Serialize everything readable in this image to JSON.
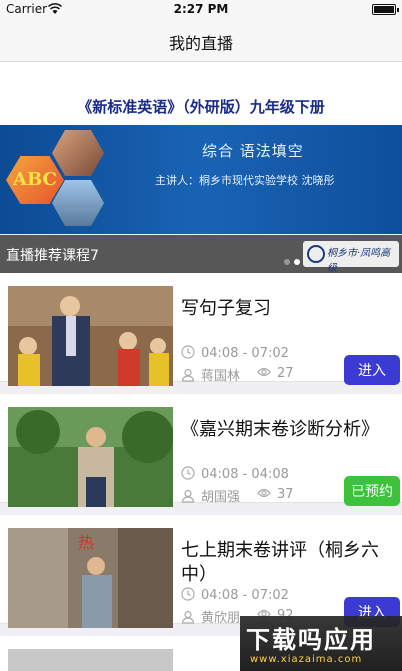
{
  "status_bar": {
    "carrier": "Carrier",
    "time": "2:27 PM",
    "battery_level": 0.9
  },
  "nav": {
    "title": "我的直播"
  },
  "banner": {
    "title": "《新标准英语》（外研版）九年级下册",
    "subject": "综合  语法填空",
    "lecturer": "主讲人：桐乡市现代实验学校  沈晓彤",
    "abc_text": "ABC",
    "overlay_label": "直播推荐课程7",
    "dots_total": 3,
    "dots_active_index": 1,
    "school_logo_text": "桐乡市·凤鸣高级"
  },
  "courses": [
    {
      "title": "写句子复习",
      "time": "04:08 - 07:02",
      "teacher": "蒋国林",
      "views": "27",
      "action": "进入",
      "action_type": "enter"
    },
    {
      "title": "《嘉兴期末卷诊断分析》",
      "time": "04:08 - 04:08",
      "teacher": "胡国强",
      "views": "37",
      "action": "已预约",
      "action_type": "reserved"
    },
    {
      "title": "七上期末卷讲评（桐乡六中）",
      "time": "04:08 - 07:02",
      "teacher": "黄欣朋",
      "views": "92",
      "action": "进入",
      "action_type": "enter"
    }
  ],
  "watermark": {
    "big": "下载吗应用",
    "small": "www.xiazaima.com"
  },
  "colors": {
    "enter": "#3c3ad4",
    "reserved": "#3ec23c",
    "banner_blue": "#1a63b4",
    "title_blue": "#1a2a8a"
  }
}
